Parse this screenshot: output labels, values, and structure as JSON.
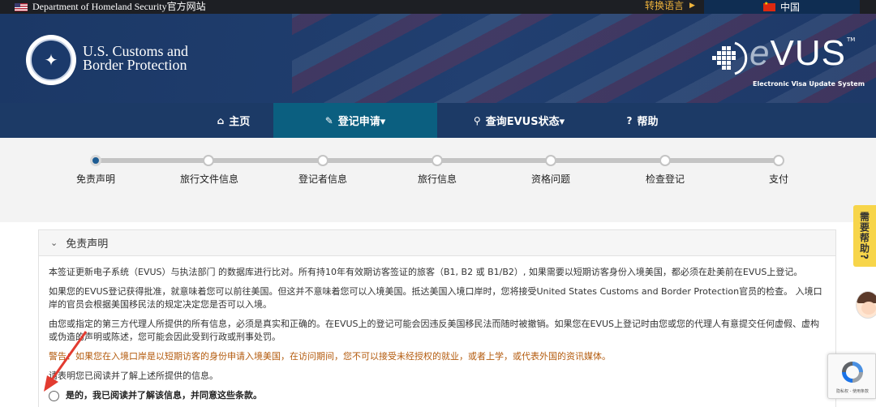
{
  "topbar": {
    "agency": "Department of Homeland Security官方网站",
    "language_toggle": "转换语言",
    "current_language": "中国"
  },
  "header": {
    "agency_line1": "U.S. Customs and",
    "agency_line2": "Border Protection",
    "system_name": "VUS",
    "system_initial": "e",
    "system_tm": "TM",
    "system_subtitle": "Electronic Visa Update System"
  },
  "nav": {
    "items": [
      {
        "label": "主页",
        "icon": "home-icon"
      },
      {
        "label": "登记申请▾",
        "icon": "pencil-icon",
        "active": true
      },
      {
        "label": "查询EVUS状态▾",
        "icon": "search-icon"
      },
      {
        "label": "帮助",
        "icon": "question-circle-icon"
      }
    ]
  },
  "progress": {
    "current_step": 1,
    "steps": [
      "免责声明",
      "旅行文件信息",
      "登记者信息",
      "旅行信息",
      "资格问题",
      "检查登记",
      "支付"
    ]
  },
  "panel": {
    "title": "免责声明",
    "paragraphs": [
      "本签证更新电子系统（EVUS）与执法部门 的数据库进行比对。所有持10年有效期访客签证的旅客（B1, B2 或 B1/B2）, 如果需要以短期访客身份入境美国，都必须在赴美前在EVUS上登记。",
      "如果您的EVUS登记获得批准，就意味着您可以前往美国。但这并不意味着您可以入境美国。抵达美国入境口岸时，您将接受United States Customs and Border Protection官员的检查。 入境口岸的官员会根据美国移民法的规定决定您是否可以入境。",
      "由您或指定的第三方代理人所提供的所有信息，必须是真实和正确的。在EVUS上的登记可能会因违反美国移民法而随时被撤销。如果您在EVUS上登记时由您或您的代理人有意提交任何虚假、虚构或伪造的声明或陈述，您可能会因此受到行政或刑事处罚。"
    ],
    "warning": "警告：如果您在入境口岸是以短期访客的身份申请入境美国，在访问期间，您不可以接受未经授权的就业，或者上学，或代表外国的资讯媒体。",
    "confirm_prompt": "请表明您已阅读并了解上述所提供的信息。",
    "agree_option": "是的，我已阅读并了解该信息，并同意这些条款。"
  },
  "sidebar": {
    "help_tab": "需要帮助?"
  },
  "recaptcha": {
    "footer": "隐私权 - 使用条款"
  },
  "colors": {
    "nav_bg": "#1c3a66",
    "nav_active": "#0b5f80",
    "warning_text": "#b35a0c",
    "help_tab_bg": "#f7d54a",
    "annotation_arrow": "#e23b30"
  }
}
